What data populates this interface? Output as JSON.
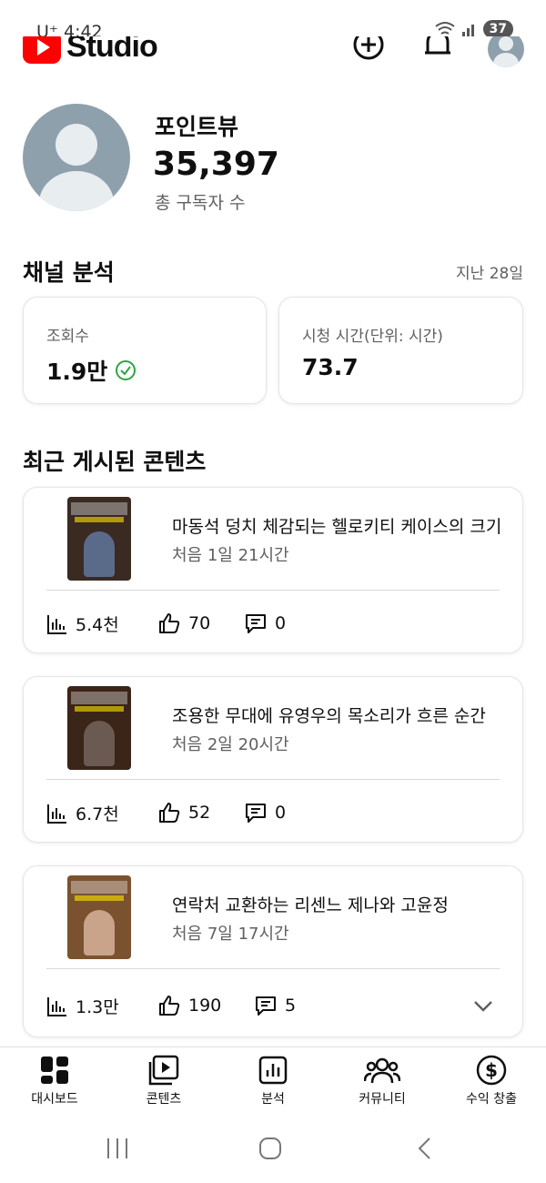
{
  "status_bar": {
    "carrier": "U⁺ 4:42",
    "battery": "37"
  },
  "header": {
    "logo_text": "Studio"
  },
  "channel": {
    "name": "포인트뷰",
    "subscribers": "35,397",
    "subscribers_label": "총 구독자 수"
  },
  "analytics": {
    "title": "채널 분석",
    "period": "지난 28일",
    "views": {
      "label": "조회수",
      "value": "1.9만"
    },
    "watch_time": {
      "label": "시청 시간(단위: 시간)",
      "value": "73.7"
    }
  },
  "recent": {
    "title": "최근 게시된 콘텐츠",
    "items": [
      {
        "title": "마동석 덩치 체감되는 헬로키티 케이스의 크기",
        "time": "처음 1일 21시간",
        "views": "5.4천",
        "likes": "70",
        "comments": "0"
      },
      {
        "title": "조용한 무대에 유영우의 목소리가 흐른 순간",
        "time": "처음 2일 20시간",
        "views": "6.7천",
        "likes": "52",
        "comments": "0"
      },
      {
        "title": "연락처 교환하는 리센느 제나와 고윤정",
        "time": "처음 7일 17시간",
        "views": "1.3만",
        "likes": "190",
        "comments": "5"
      }
    ]
  },
  "nav": {
    "dashboard": "대시보드",
    "content": "콘텐츠",
    "analytics": "분석",
    "community": "커뮤니티",
    "earn": "수익 창출"
  },
  "colors": {
    "brand_red": "#ff0000",
    "check_green": "#2ba640",
    "avatar_bg": "#8fa0ad"
  }
}
